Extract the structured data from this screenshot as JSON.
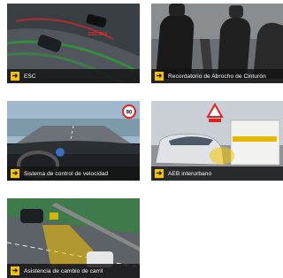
{
  "features": [
    {
      "label": "ESC",
      "icon": "arrow-right-icon",
      "scene": "car drifting on curved road with ESC OFF marker"
    },
    {
      "label": "Recordatorio de Abrocho de Cinturón",
      "icon": "arrow-right-icon",
      "scene": "car interior seats"
    },
    {
      "label": "Sistema de control de velocidad",
      "icon": "arrow-right-icon",
      "scene": "driver view on highway with speed sign"
    },
    {
      "label": "AEB interurbano",
      "icon": "arrow-right-icon",
      "scene": "car braking behind van with warning triangle"
    },
    {
      "label": "Asistencia de cambio de carril",
      "icon": "arrow-right-icon",
      "scene": "car on road with lane detection zone"
    }
  ],
  "colors": {
    "accent": "#f5c400",
    "label_bg": "#141414",
    "text": "#ffffff"
  },
  "scene_text": {
    "esc_off": "ESC OFF",
    "speed_sign": "90"
  }
}
